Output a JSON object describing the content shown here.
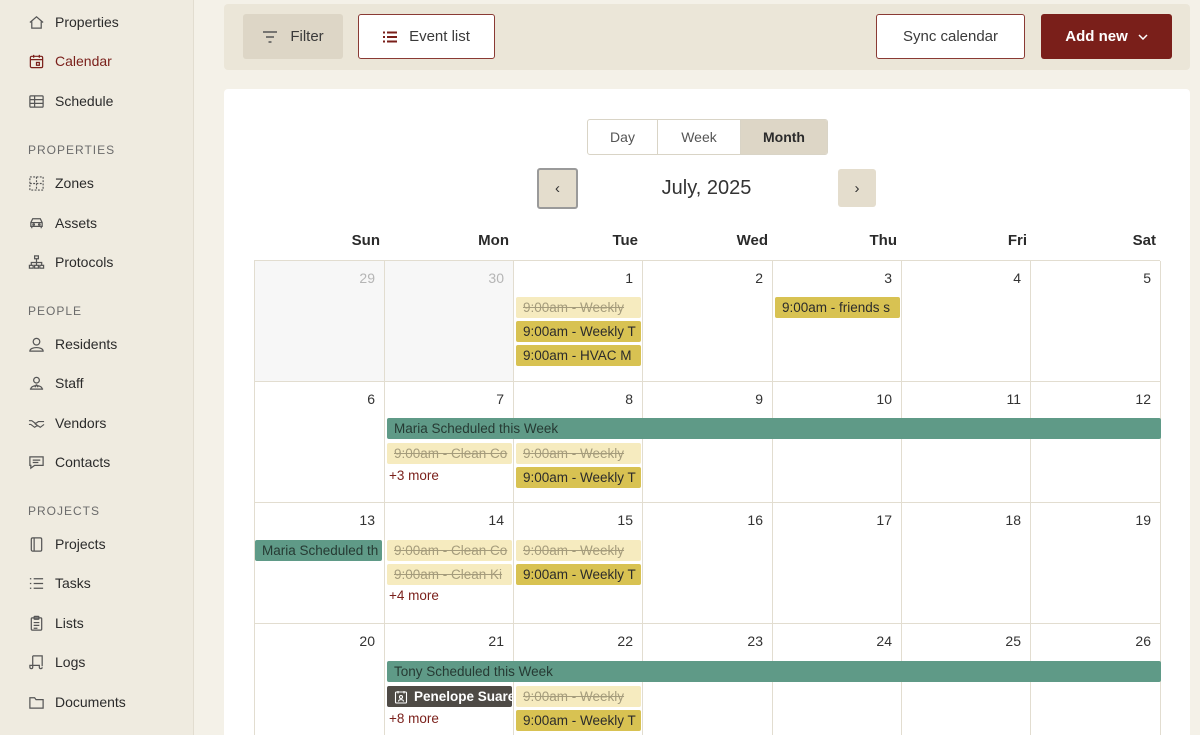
{
  "sidebar": {
    "items": [
      {
        "label": "Properties",
        "icon": "home-icon"
      },
      {
        "label": "Calendar",
        "icon": "calendar-icon"
      },
      {
        "label": "Schedule",
        "icon": "table-icon"
      },
      {
        "label": "Zones",
        "icon": "zones-icon"
      },
      {
        "label": "Assets",
        "icon": "car-icon"
      },
      {
        "label": "Protocols",
        "icon": "hierarchy-icon"
      },
      {
        "label": "Residents",
        "icon": "person-icon"
      },
      {
        "label": "Staff",
        "icon": "staff-icon"
      },
      {
        "label": "Vendors",
        "icon": "handshake-icon"
      },
      {
        "label": "Contacts",
        "icon": "chat-icon"
      },
      {
        "label": "Projects",
        "icon": "notebook-icon"
      },
      {
        "label": "Tasks",
        "icon": "list-icon"
      },
      {
        "label": "Lists",
        "icon": "clipboard-icon"
      },
      {
        "label": "Logs",
        "icon": "scroll-icon"
      },
      {
        "label": "Documents",
        "icon": "folder-icon"
      }
    ],
    "sections": [
      "PROPERTIES",
      "PEOPLE",
      "PROJECTS"
    ]
  },
  "toolbar": {
    "filter_label": "Filter",
    "event_list_label": "Event list",
    "sync_label": "Sync calendar",
    "add_label": "Add new"
  },
  "calendar": {
    "views": [
      "Day",
      "Week",
      "Month"
    ],
    "selected_view": "Month",
    "prev_label": "‹",
    "next_label": "›",
    "month_title": "July, 2025",
    "weekdays": [
      "Sun",
      "Mon",
      "Tue",
      "Wed",
      "Thu",
      "Fri",
      "Sat"
    ],
    "weeks": [
      [
        "29",
        "30",
        "1",
        "2",
        "3",
        "4",
        "5"
      ],
      [
        "6",
        "7",
        "8",
        "9",
        "10",
        "11",
        "12"
      ],
      [
        "13",
        "14",
        "15",
        "16",
        "17",
        "18",
        "19"
      ],
      [
        "20",
        "21",
        "22",
        "23",
        "24",
        "25",
        "26"
      ]
    ],
    "events": {
      "w1_tue_1": "9:00am - Weekly",
      "w1_tue_2": "9:00am - Weekly T",
      "w1_tue_3": "9:00am - HVAC M",
      "w1_thu_1": "9:00am - friends s",
      "w2_bar": "Maria Scheduled this Week",
      "w2_mon_1": "9:00am - Clean Co",
      "w2_mon_more": "+3 more",
      "w2_tue_1": "9:00am - Weekly",
      "w2_tue_2": "9:00am - Weekly T",
      "w3_bar": "Maria Scheduled th",
      "w3_mon_1": "9:00am - Clean Co",
      "w3_mon_2": "9:00am - Clean Ki",
      "w3_mon_more": "+4 more",
      "w3_tue_1": "9:00am - Weekly",
      "w3_tue_2": "9:00am - Weekly T",
      "w4_bar": "Tony Scheduled this Week",
      "w4_mon_1": "Penelope Suare",
      "w4_mon_more": "+8 more",
      "w4_tue_1": "9:00am - Weekly",
      "w4_tue_2": "9:00am - Weekly T"
    }
  },
  "colors": {
    "accent": "#7a1f1a",
    "event_done": "#f6ebbf",
    "event_todo": "#d8c252",
    "event_bar": "#5f9a87",
    "event_dark": "#4e4a45"
  }
}
